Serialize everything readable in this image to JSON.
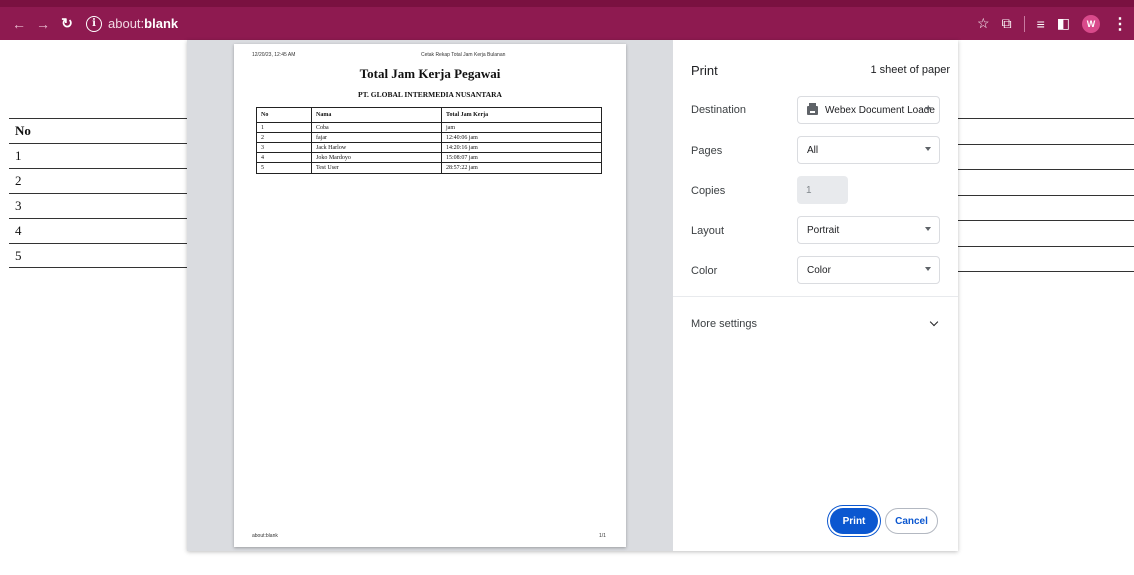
{
  "browser": {
    "url_prefix": "about:",
    "url_host": "blank",
    "profile_initial": "W",
    "theme_color": "#8e1a50"
  },
  "background_table": {
    "header": "No",
    "rows": [
      "1",
      "2",
      "3",
      "4",
      "5"
    ]
  },
  "preview": {
    "date": "12/20/23, 12:45 AM",
    "header_title": "Cetak Rekap Total Jam Kerja Bulanan",
    "title": "Total Jam Kerja Pegawai",
    "company": "PT. GLOBAL INTERMEDIA NUSANTARA",
    "columns": [
      "No",
      "Nama",
      "Total Jam Kerja"
    ],
    "rows": [
      [
        "1",
        "Coba",
        "jam"
      ],
      [
        "2",
        "fajar",
        "12:40:06 jam"
      ],
      [
        "3",
        "Jack Harlow",
        "14:20:16 jam"
      ],
      [
        "4",
        "Joko Mardoyo",
        "15:08:07 jam"
      ],
      [
        "5",
        "Test User",
        "28:57:22 jam"
      ]
    ],
    "footer_url": "about:blank",
    "footer_page": "1/1"
  },
  "settings": {
    "title": "Print",
    "sheets": "1 sheet of paper",
    "destination_label": "Destination",
    "destination_value": "Webex Document Loade",
    "pages_label": "Pages",
    "pages_value": "All",
    "copies_label": "Copies",
    "copies_value": "1",
    "layout_label": "Layout",
    "layout_value": "Portrait",
    "color_label": "Color",
    "color_value": "Color",
    "more_settings": "More settings",
    "print_button": "Print",
    "cancel_button": "Cancel",
    "accent_color": "#0b57d0"
  }
}
